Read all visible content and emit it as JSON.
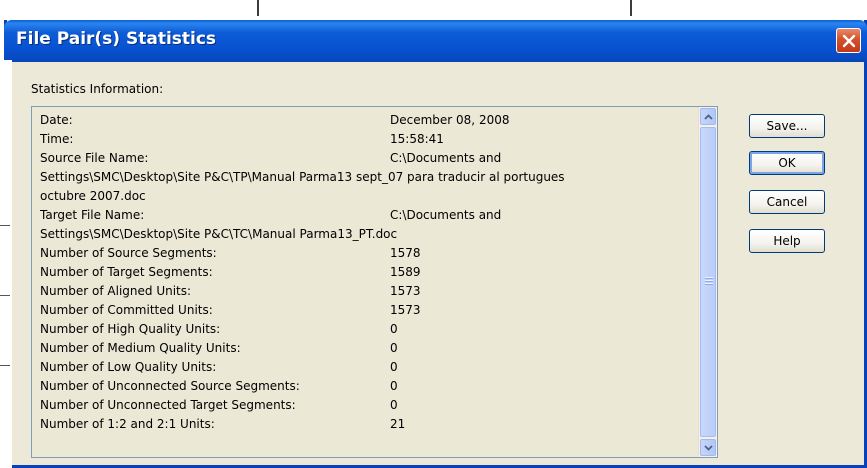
{
  "dialog": {
    "title": "File Pair(s) Statistics",
    "section_label": "Statistics Information:",
    "buttons": {
      "save": "Save...",
      "ok": "OK",
      "cancel": "Cancel",
      "help": "Help"
    }
  },
  "stats": {
    "date_label": "Date:",
    "date_value": "December 08, 2008",
    "time_label": "Time:",
    "time_value": "15:58:41",
    "source_label": "Source File Name:",
    "source_value": "C:\\Documents and",
    "source_cont1": "Settings\\SMC\\Desktop\\Site P&C\\TP\\Manual Parma13 sept_07 para traducir al portugues",
    "source_cont2": "octubre 2007.doc",
    "target_label": "Target File Name:",
    "target_value": "C:\\Documents and",
    "target_cont1": "Settings\\SMC\\Desktop\\Site P&C\\TC\\Manual Parma13_PT.doc",
    "rows": [
      {
        "label": "Number of Source Segments:",
        "value": "1578"
      },
      {
        "label": "Number of Target Segments:",
        "value": "1589"
      },
      {
        "label": "Number of Aligned Units:",
        "value": "1573"
      },
      {
        "label": "Number of Committed Units:",
        "value": "1573"
      },
      {
        "label": "Number of High Quality Units:",
        "value": "0"
      },
      {
        "label": "Number of Medium Quality Units:",
        "value": "0"
      },
      {
        "label": "Number of Low Quality Units:",
        "value": "0"
      },
      {
        "label": "Number of Unconnected Source Segments:",
        "value": "0"
      },
      {
        "label": "Number of Unconnected Target Segments:",
        "value": "0"
      },
      {
        "label": "Number of 1:2 and 2:1 Units:",
        "value": "21"
      }
    ]
  },
  "icons": {
    "close": "close-icon",
    "scroll_up": "chevron-up-icon",
    "scroll_down": "chevron-down-icon"
  },
  "colors": {
    "titlebar": "#0751d0",
    "close_button": "#d5512b",
    "dialog_background": "#ece9d8",
    "button_border": "#003c74"
  }
}
